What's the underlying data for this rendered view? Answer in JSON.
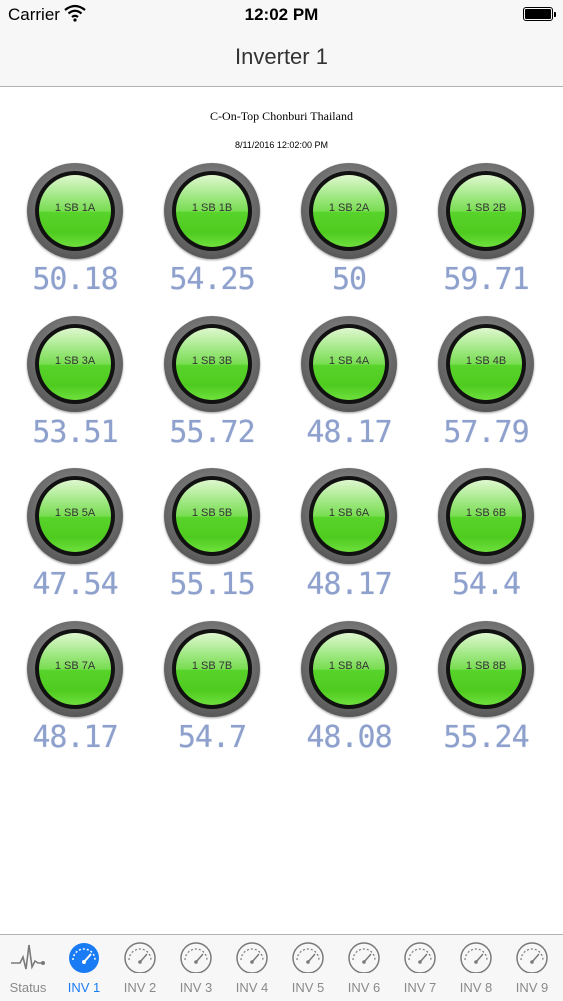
{
  "status_bar": {
    "carrier": "Carrier",
    "time": "12:02 PM"
  },
  "nav": {
    "title": "Inverter 1"
  },
  "site": {
    "name": "C-On-Top Chonburi Thailand",
    "timestamp": "8/11/2016 12:02:00 PM"
  },
  "gauges": [
    {
      "label": "1 SB 1A",
      "reading": "50.18"
    },
    {
      "label": "1 SB 1B",
      "reading": "54.25"
    },
    {
      "label": "1 SB 2A",
      "reading": "50"
    },
    {
      "label": "1 SB 2B",
      "reading": "59.71"
    },
    {
      "label": "1 SB 3A",
      "reading": "53.51"
    },
    {
      "label": "1 SB 3B",
      "reading": "55.72"
    },
    {
      "label": "1 SB 4A",
      "reading": "48.17"
    },
    {
      "label": "1 SB 4B",
      "reading": "57.79"
    },
    {
      "label": "1 SB 5A",
      "reading": "47.54"
    },
    {
      "label": "1 SB 5B",
      "reading": "55.15"
    },
    {
      "label": "1 SB 6A",
      "reading": "48.17"
    },
    {
      "label": "1 SB 6B",
      "reading": "54.4"
    },
    {
      "label": "1 SB 7A",
      "reading": "48.17"
    },
    {
      "label": "1 SB 7B",
      "reading": "54.7"
    },
    {
      "label": "1 SB 8A",
      "reading": "48.08"
    },
    {
      "label": "1 SB 8B",
      "reading": "55.24"
    }
  ],
  "tabs": [
    {
      "label": "Status",
      "icon": "pulse-icon"
    },
    {
      "label": "INV 1",
      "icon": "speedometer-icon"
    },
    {
      "label": "INV 2",
      "icon": "speedometer-icon"
    },
    {
      "label": "INV 3",
      "icon": "speedometer-icon"
    },
    {
      "label": "INV 4",
      "icon": "speedometer-icon"
    },
    {
      "label": "INV 5",
      "icon": "speedometer-icon"
    },
    {
      "label": "INV 6",
      "icon": "speedometer-icon"
    },
    {
      "label": "INV 7",
      "icon": "speedometer-icon"
    },
    {
      "label": "INV 8",
      "icon": "speedometer-icon"
    },
    {
      "label": "INV 9",
      "icon": "speedometer-icon"
    }
  ],
  "active_tab": "INV 1",
  "colors": {
    "accent": "#1a7cf5",
    "gauge_green": "#5ad32c",
    "reading": "#8ea0cc",
    "inactive_tab": "#8a8a8a"
  }
}
